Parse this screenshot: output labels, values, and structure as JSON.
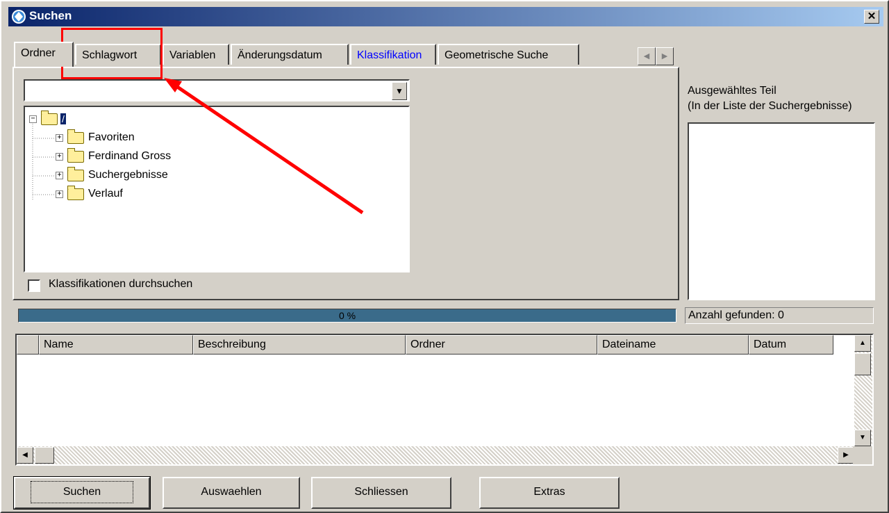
{
  "window": {
    "title": "Suchen",
    "close_symbol": "✕"
  },
  "tabs": [
    {
      "label": "Ordner",
      "active": true
    },
    {
      "label": "Schlagwort"
    },
    {
      "label": "Variablen"
    },
    {
      "label": "Änderungsdatum"
    },
    {
      "label": "Klassifikation",
      "color": "#0000ff"
    },
    {
      "label": "Geometrische Suche"
    }
  ],
  "tab_scroll": {
    "left": "◀",
    "right": "▶"
  },
  "folder_combo": {
    "value": "",
    "arrow": "▼"
  },
  "tree": {
    "root": {
      "label": "/",
      "expander": "−"
    },
    "children": [
      {
        "label": "Favoriten",
        "expander": "+"
      },
      {
        "label": "Ferdinand Gross",
        "expander": "+"
      },
      {
        "label": "Suchergebnisse",
        "expander": "+"
      },
      {
        "label": "Verlauf",
        "expander": "+"
      }
    ]
  },
  "checkbox": {
    "label": "Klassifikationen durchsuchen",
    "checked": false
  },
  "selected_part": {
    "line1": "Ausgewähltes Teil",
    "line2": "(In der Liste der Suchergebnisse)"
  },
  "progress": {
    "percent": 0,
    "text": "0 %"
  },
  "found": {
    "text": "Anzahl gefunden: 0"
  },
  "results_table": {
    "columns": [
      "Name",
      "Beschreibung",
      "Ordner",
      "Dateiname",
      "Datum"
    ],
    "rows": []
  },
  "scroll_arrows": {
    "up": "▲",
    "down": "▼",
    "left": "◀",
    "right": "▶"
  },
  "buttons": {
    "search": "Suchen",
    "select": "Auswaehlen",
    "close": "Schliessen",
    "extras": "Extras"
  },
  "colors": {
    "annotation": "#ff0000",
    "titlebar": "#0a246a",
    "progress": "#3a6b8a"
  }
}
